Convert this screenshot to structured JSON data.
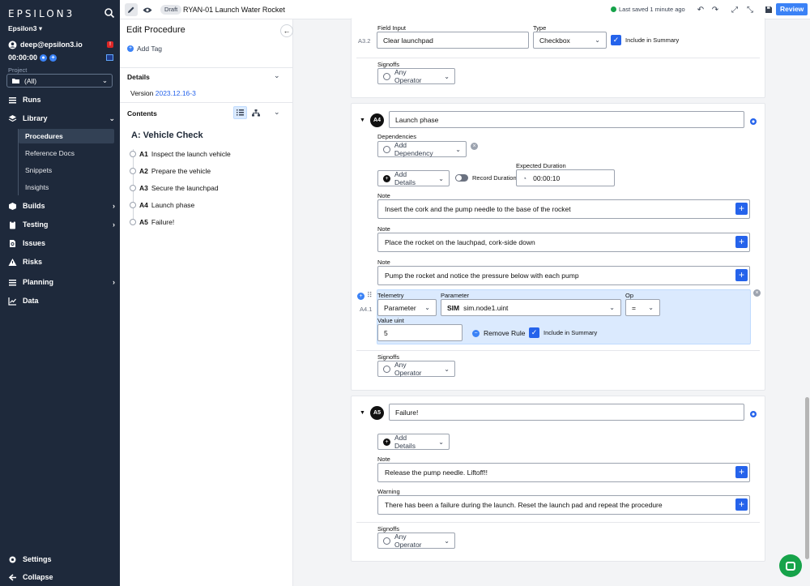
{
  "sidebar": {
    "logo": "EPSILON3",
    "workspace": "Epsilon3",
    "user_email": "deep@epsilon3.io",
    "alert_count": "!",
    "timer": "00:00:00",
    "project_label": "Project",
    "project_value": "(All)",
    "nav": {
      "runs": "Runs",
      "library": "Library",
      "procedures": "Procedures",
      "reference_docs": "Reference Docs",
      "snippets": "Snippets",
      "insights": "Insights",
      "builds": "Builds",
      "testing": "Testing",
      "issues": "Issues",
      "risks": "Risks",
      "planning": "Planning",
      "data": "Data",
      "settings": "Settings",
      "collapse": "Collapse"
    }
  },
  "topbar": {
    "status_badge": "Draft",
    "title": "RYAN-01 Launch Water Rocket",
    "saved": "Last saved 1 minute ago",
    "review": "Review"
  },
  "panel": {
    "title": "Edit Procedure",
    "add_tag": "Add Tag",
    "details": "Details",
    "version_label": "Version",
    "version_value": "2023.12.16-3",
    "contents": "Contents",
    "section_title": "A: Vehicle Check",
    "steps": [
      {
        "num": "A1",
        "name": "Inspect the launch vehicle"
      },
      {
        "num": "A2",
        "name": "Prepare the vehicle"
      },
      {
        "num": "A3",
        "name": "Secure the launchpad"
      },
      {
        "num": "A4",
        "name": "Launch phase"
      },
      {
        "num": "A5",
        "name": "Failure!"
      }
    ]
  },
  "main": {
    "a3": {
      "field_input_label": "Field Input",
      "type_label": "Type",
      "step_no": "A3.2",
      "field_input_value": "Clear launchpad",
      "type_value": "Checkbox",
      "include_summary": "Include in Summary",
      "signoffs_label": "Signoffs",
      "signoff_value": "Any Operator"
    },
    "a4": {
      "badge": "A4",
      "name": "Launch phase",
      "dependencies_label": "Dependencies",
      "add_dependency": "Add Dependency",
      "add_details": "Add Details",
      "record_duration": "Record Duration",
      "expected_duration_label": "Expected Duration",
      "expected_duration_value": "00:00:10",
      "note_label": "Note",
      "notes": [
        "Insert the cork and the pump needle to the base of the rocket",
        "Place the rocket on the lauchpad, cork-side down",
        "Pump the rocket and notice the pressure below with each pump"
      ],
      "telemetry": {
        "step_no": "A4.1",
        "telemetry_label": "Telemetry",
        "telemetry_value": "Parameter",
        "parameter_label": "Parameter",
        "parameter_prefix": "SIM",
        "parameter_value": "sim.node1.uint",
        "op_label": "Op",
        "op_value": "=",
        "value_label": "Value uint",
        "value": "5",
        "remove_rule": "Remove Rule",
        "include_summary": "Include in Summary"
      },
      "signoffs_label": "Signoffs",
      "signoff_value": "Any Operator"
    },
    "a5": {
      "badge": "A5",
      "name": "Failure!",
      "add_details": "Add Details",
      "note_label": "Note",
      "note": "Release the pump needle.  Liftoff!!",
      "warning_label": "Warning",
      "warning": "There has been a failure during the launch.  Reset the launch pad and repeat the procedure",
      "signoffs_label": "Signoffs",
      "signoff_value": "Any Operator"
    }
  },
  "colors": {
    "sidebar_bg": "#1e293b",
    "accent": "#3b82f6",
    "telemetry_bg": "#dbeafe",
    "saved_ok": "#16a34a"
  }
}
